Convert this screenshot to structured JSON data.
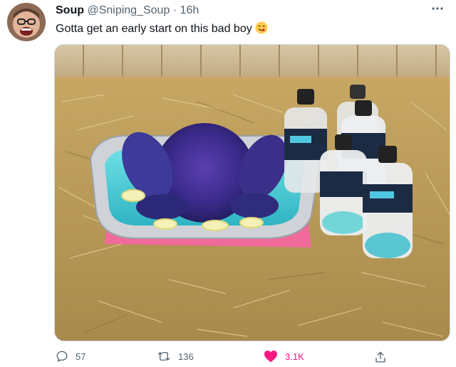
{
  "author": {
    "name": "Soup",
    "handle": "@Sniping_Soup",
    "separator": "·",
    "time": "16h",
    "avatar": "avatar-photo"
  },
  "more_icon": "more-dots-icon",
  "tweet": {
    "text": "Gotta get an early start on this bad boy",
    "emoji": "yum-face-emoji"
  },
  "media": {
    "description_icon": "photo"
  },
  "actions": {
    "reply": {
      "icon": "reply-icon",
      "count": "57"
    },
    "retweet": {
      "icon": "retweet-icon",
      "count": "136"
    },
    "like": {
      "icon": "heart-icon",
      "count": "3.1K",
      "liked": true
    },
    "share": {
      "icon": "share-icon"
    }
  },
  "colors": {
    "secondary_text": "#536471",
    "like": "#f91880",
    "border": "#cfd9de"
  }
}
